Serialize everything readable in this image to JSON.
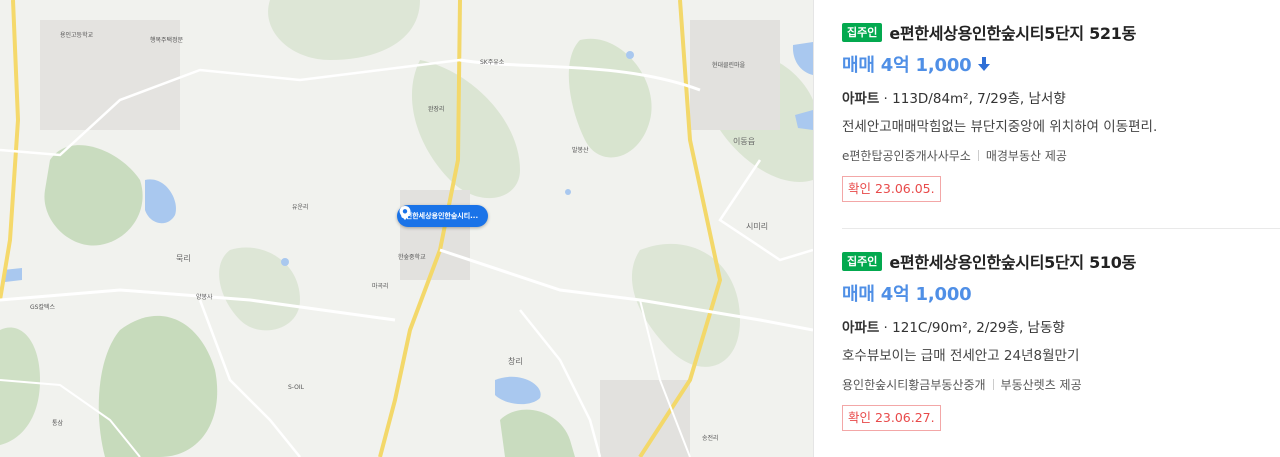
{
  "map": {
    "pin_label": "e편한세상용인한숲시티...",
    "place_labels": [
      "용인고등학교",
      "행복주택정문",
      "현대클린마을",
      "완장리",
      "발봉산",
      "이동읍",
      "시미리",
      "묵리",
      "유운리",
      "한숲중학교",
      "마곡리",
      "양봉사",
      "창리",
      "S-OIL",
      "GS칼텍스",
      "SK주유소",
      "송전리",
      "통삼"
    ]
  },
  "listings": [
    {
      "badge": "집주인",
      "title": "e편한세상용인한숲시티5단지 521동",
      "price": "매매 4억 1,000",
      "price_trend": "down",
      "type": "아파트",
      "spec": " · 113D/84m², 7/29층, 남서향",
      "description": "전세안고매매막힘없는 뷰단지중앙에 위치하여 이동편리.",
      "agency": "e편한탑공인중개사사무소",
      "provider": "매경부동산 제공",
      "confirm": "확인 23.06.05."
    },
    {
      "badge": "집주인",
      "title": "e편한세상용인한숲시티5단지 510동",
      "price": "매매 4억 1,000",
      "price_trend": "",
      "type": "아파트",
      "spec": " · 121C/90m², 2/29층, 남동향",
      "description": "호수뷰보이는 급매 전세안고 24년8월만기",
      "agency": "용인한숲시티황금부동산중개",
      "provider": "부동산렛츠 제공",
      "confirm": "확인 23.06.27."
    }
  ],
  "colors": {
    "badge_green": "#03a94f",
    "price_blue": "#4f8fe6",
    "confirm_red": "#e84a4a",
    "pin_blue": "#1a73e8"
  }
}
